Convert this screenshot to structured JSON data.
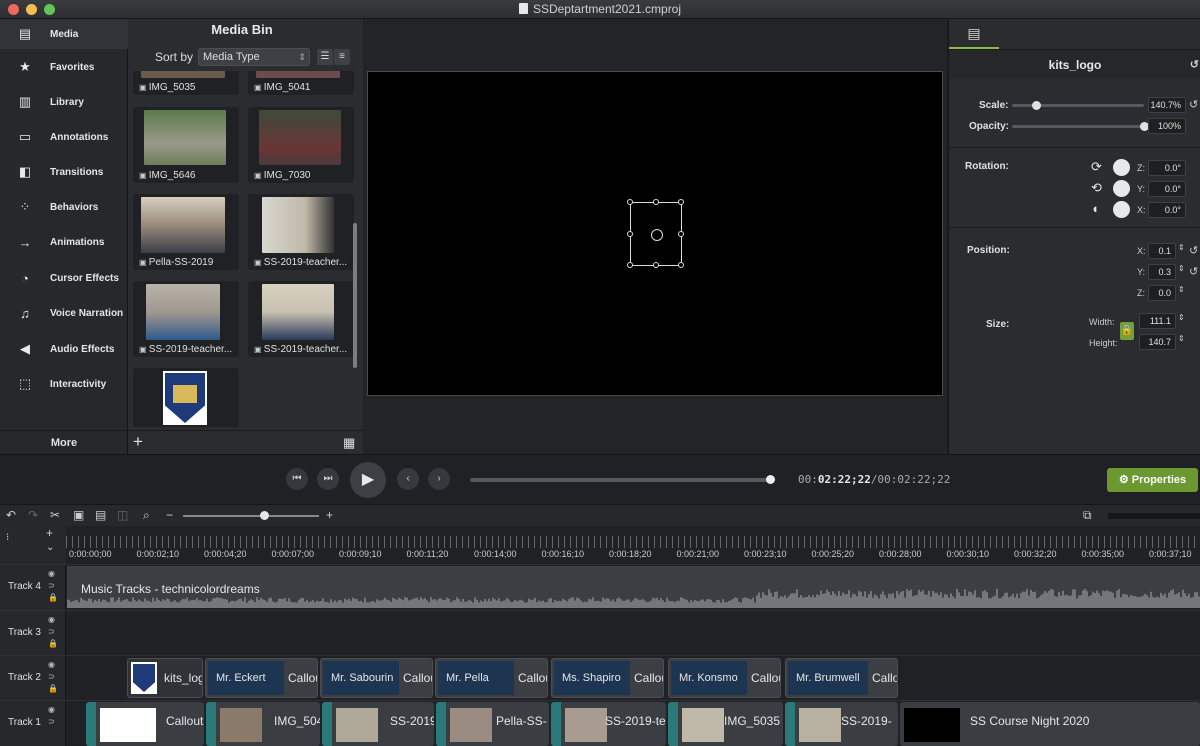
{
  "window": {
    "title": "SSDeptartment2021.cmproj"
  },
  "sidebar": {
    "items": [
      {
        "label": "Media",
        "icon": "film-strip-icon"
      },
      {
        "label": "Favorites",
        "icon": "star-icon"
      },
      {
        "label": "Library",
        "icon": "library-icon"
      },
      {
        "label": "Annotations",
        "icon": "annotation-icon"
      },
      {
        "label": "Transitions",
        "icon": "transition-icon"
      },
      {
        "label": "Behaviors",
        "icon": "behavior-icon"
      },
      {
        "label": "Animations",
        "icon": "animation-icon"
      },
      {
        "label": "Cursor Effects",
        "icon": "cursor-icon"
      },
      {
        "label": "Voice Narration",
        "icon": "microphone-icon"
      },
      {
        "label": "Audio Effects",
        "icon": "speaker-icon"
      },
      {
        "label": "Interactivity",
        "icon": "interactivity-icon"
      }
    ],
    "more": "More"
  },
  "mediabin": {
    "title": "Media Bin",
    "sort_label": "Sort by",
    "sort_value": "Media Type",
    "tiles": [
      "IMG_5035",
      "IMG_5041",
      "IMG_5646",
      "IMG_7030",
      "Pella-SS-2019",
      "SS-2019-teacher...",
      "SS-2019-teacher...",
      "SS-2019-teacher...",
      ""
    ]
  },
  "properties": {
    "title": "kits_logo",
    "scale_label": "Scale:",
    "scale": "140.7%",
    "scale_level": 0.18,
    "opacity_label": "Opacity:",
    "opacity": "100%",
    "opacity_level": 1.0,
    "rotation_label": "Rotation:",
    "rot_z": "0.0°",
    "rot_y": "0.0°",
    "rot_x": "0.0°",
    "position_label": "Position:",
    "pos_x": "0.1",
    "pos_y": "0.3",
    "pos_z": "0.0",
    "size_label": "Size:",
    "width_label": "Width:",
    "width": "111.1",
    "height_label": "Height:",
    "height": "140.7",
    "z": "Z:",
    "y": "Y:",
    "x": "X:"
  },
  "playback": {
    "timecode_current": "02:22;22",
    "timecode_prefix": "00:",
    "timecode_total": "/00:02:22;22",
    "progress": 1.0,
    "properties_button": "Properties"
  },
  "ruler": {
    "ticks": [
      "0:00:00;00",
      "0:00:02;10",
      "0:00:04;20",
      "0:00:07;00",
      "0:00:09;10",
      "0:00:11;20",
      "0:00:14;00",
      "0:00:16;10",
      "0:00:18;20",
      "0:00:21;00",
      "0:00:23;10",
      "0:00:25;20",
      "0:00:28;00",
      "0:00:30;10",
      "0:00:32;20",
      "0:00:35;00",
      "0:00:37;10"
    ]
  },
  "tracks": {
    "t4": "Track 4",
    "t3": "Track 3",
    "t2": "Track 2",
    "t1": "Track 1",
    "music": "Music Tracks - technicolordreams",
    "kits": "kits_log",
    "callouts": [
      {
        "name": "Mr. Eckert",
        "tail": "Callou"
      },
      {
        "name": "Mr. Sabourin",
        "tail": "Callou"
      },
      {
        "name": "Mr. Pella",
        "tail": "Callou"
      },
      {
        "name": "Ms. Shapiro",
        "tail": "Callou"
      },
      {
        "name": "Mr. Konsmo",
        "tail": "Callou"
      },
      {
        "name": "Mr. Brumwell",
        "tail": "Callo"
      }
    ],
    "video": [
      "Callout",
      "IMG_504",
      "SS-2019",
      "Pella-SS-",
      "SS-2019-te",
      "IMG_5035",
      "SS-2019-",
      "SS Course Night 2020"
    ]
  }
}
